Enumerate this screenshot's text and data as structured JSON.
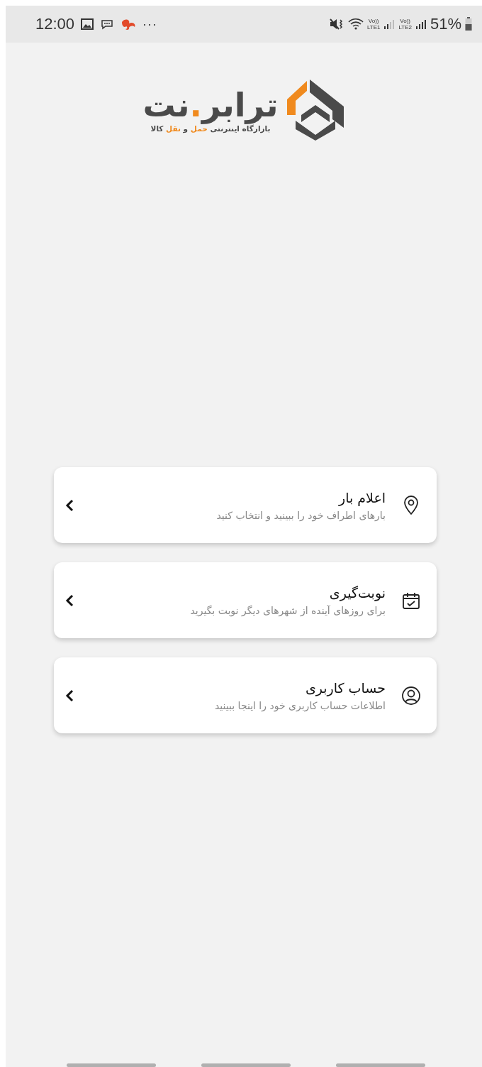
{
  "status_bar": {
    "time": "12:00",
    "more": "···",
    "sim_1": {
      "top": "Vo))",
      "bottom": "LTE1"
    },
    "sim_2": {
      "top": "Vo))",
      "bottom": "LTE2"
    },
    "battery": "51%"
  },
  "logo": {
    "name_parts": [
      {
        "text": "ترابر",
        "accent": false
      },
      {
        "text": ".",
        "accent": true
      },
      {
        "text": "نت",
        "accent": false
      }
    ],
    "tagline_parts": [
      {
        "text": "بازارگاه اینترنتی ",
        "accent": false
      },
      {
        "text": "حمل",
        "accent": true
      },
      {
        "text": " و ",
        "accent": false
      },
      {
        "text": "نقل",
        "accent": true
      },
      {
        "text": " کالا",
        "accent": false
      }
    ]
  },
  "menu": [
    {
      "kind": "pin",
      "title": "اعلام بار",
      "subtitle": "بارهای اطراف خود را ببینید و انتخاب کنید"
    },
    {
      "kind": "calendar",
      "title": "نوبت‌گیری",
      "subtitle": "برای روزهای آینده از شهرهای دیگر نوبت بگیرید"
    },
    {
      "kind": "user",
      "title": "حساب کاربری",
      "subtitle": "اطلاعات حساب کاربری خود را اینجا ببینید"
    }
  ]
}
